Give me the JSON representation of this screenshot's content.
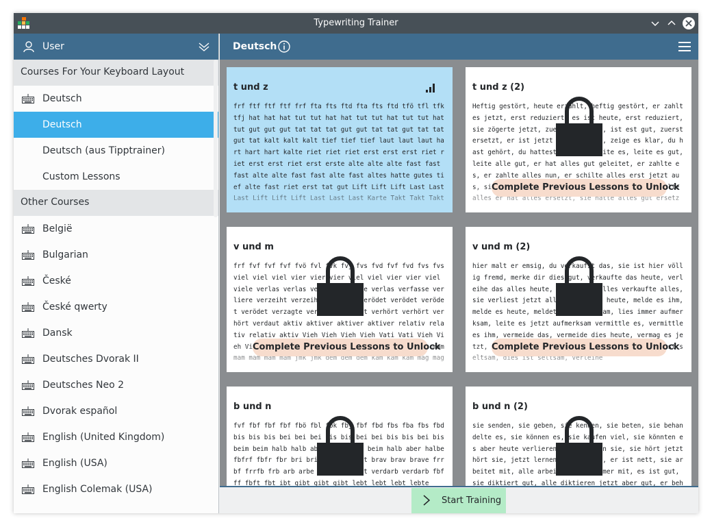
{
  "window": {
    "title": "Typewriting Trainer"
  },
  "sidebar": {
    "user_label": "User",
    "section_keyboard": "Courses For Your Keyboard Layout",
    "keyboard_courses": [
      {
        "label": "Deutsch",
        "icon": "keyboard-icon"
      },
      {
        "label": "Deutsch",
        "icon": ""
      },
      {
        "label": "Deutsch (aus Tipptrainer)",
        "icon": ""
      },
      {
        "label": "Custom Lessons",
        "icon": ""
      }
    ],
    "section_other": "Other Courses",
    "other_courses": [
      "België",
      "Bulgarian",
      "České",
      "České qwerty",
      "Dansk",
      "Deutsches Dvorak II",
      "Deutsches Neo 2",
      "Dvorak español",
      "English (United Kingdom)",
      "English (USA)",
      "English Colemak (USA)"
    ]
  },
  "main": {
    "course_title": "Deutsch",
    "lock_label": "Complete Previous Lessons to Unlock",
    "start_label": "Start Training"
  },
  "lessons": [
    {
      "title": "t und z",
      "locked": false,
      "text": "frf ftf ftf ftf frf fta fts ftd fta fts ftd tfö tfl tfk tfj hat hat hat tut tut hat hat tut tut hat tut tut hat tut gut gut gut tat tat tat gut gut tat tat gut tat tat gut tat kalt kalt kalt tief tief tief laut laut laut hart hart hart kalte riet riet riet erst erst erst riet riet erst erst riet erst erste alte alte alte fast fast fast alte alte fast fast alte fast altes hatte gutes tief alte fast riet erst tat gut Lift Lift Lift Last Last Last Lift Lift Lift Last Last Last Karte Takt Takt Takt Teig Teig Teig Takt Takt Teig Takt"
    },
    {
      "title": "t und z (2)",
      "locked": true,
      "text": "Heftig gestört, heute erzählt, heftig gestört, er zahlt es jetzt, erst reduziert, es ist heute, erst reduziert, sie zögerte jetzt, zuerst ertragen, ist est gut, zuerst ersetzt, er ist jetzt hier, zuerst, zeige es klar, du hast gehört, du hattest gelernt, leite es, leite es gut, leite alle gut, er hat alles gut geleitet, er zahlte es, er zahlte alles nun, er schilte alles erst jetzt aus, sie teilte es, sie teilte alles erst nun, es teilte alles er hat alles ersetzt, sie hatte alles gut ersetzt, er"
    },
    {
      "title": "v und m",
      "locked": true,
      "text": "frf fvf fvf fvf fvö fvl fvk fvj fvs fvd fvf fvd fvs fvs viel viel viel vier vier vier viel viel vier vier viel viele verlas verlas verlas verfasse verlas verfasse verliere verzeiht verzeiht verkehrt verödet verödet verödet verödet verzagte verzagte verzagt verhört verhört verhört verdaut aktiv aktiver aktiver aktiver relativ relativ relativ aktiv Vieh Vieh Vieh Vieh Vati Vati Vieh Vieh Vieh Vati Vieh Verse juj jmj jmj jmj jmj mam mam mam mam mam mam mam jmk jmk dem dem dem kam kam kam mag mag mag dem Kam kam mag mag"
    },
    {
      "title": "v und m (2)",
      "locked": true,
      "text": "hier malt er emsig, du verkaufst das, sie ist hier völlig fremd, merke dir dies gut, verkaufte das heute, verleihe das alles heute, er hat das alles verkaufte alles, sie verliest jetzt alles, melde es heute, melde es ihm, melde es heute, meldet es aufmerksam, lies immer aufmerksam, leite es jetzt aufmerksam vermittle es, vermittle es ihm, vermeide das, vermeide dies heute, vermag es jetzt, sie ist aufmerksam, er hat sie sehr gut dies ist seltsam, dies ist seltsam, verleihe"
    },
    {
      "title": "b und n",
      "locked": true,
      "text": "fvf fbf fbf fbf fbö fbl fbk fbj fbf fbd fbs fba fbs fbd bis bis bis bei bei bei bis bis bei bei bis bis bei bis beim beim halb halb aber aber beim beim halb aber halbe fbfrf fbfr fbr bri brie brief breit brav brav brave frrbf frrfb frb arb arbe arbeit beitet verdarb verdarb fbfff fbft fbt ibt gibt gibt gibt lebt lebt lebt lebte"
    },
    {
      "title": "b und n (2)",
      "locked": true,
      "text": "sie senden, sie geben, sie kennen, sie beten, sie behandelte es, sie können es, sie kaufen viel, sie könnten es aber heute verlieren jetzt bitten sie, sie hört jetzt hört sie, jetzt lernen sie es aber, er ist nett, sie arbeitet mit, alle arbeiten jetzt immer mit, es ist gut, sie diktiert gut, alle diktieren jetzt aber gut, er behandelt es, er lebte"
    }
  ]
}
